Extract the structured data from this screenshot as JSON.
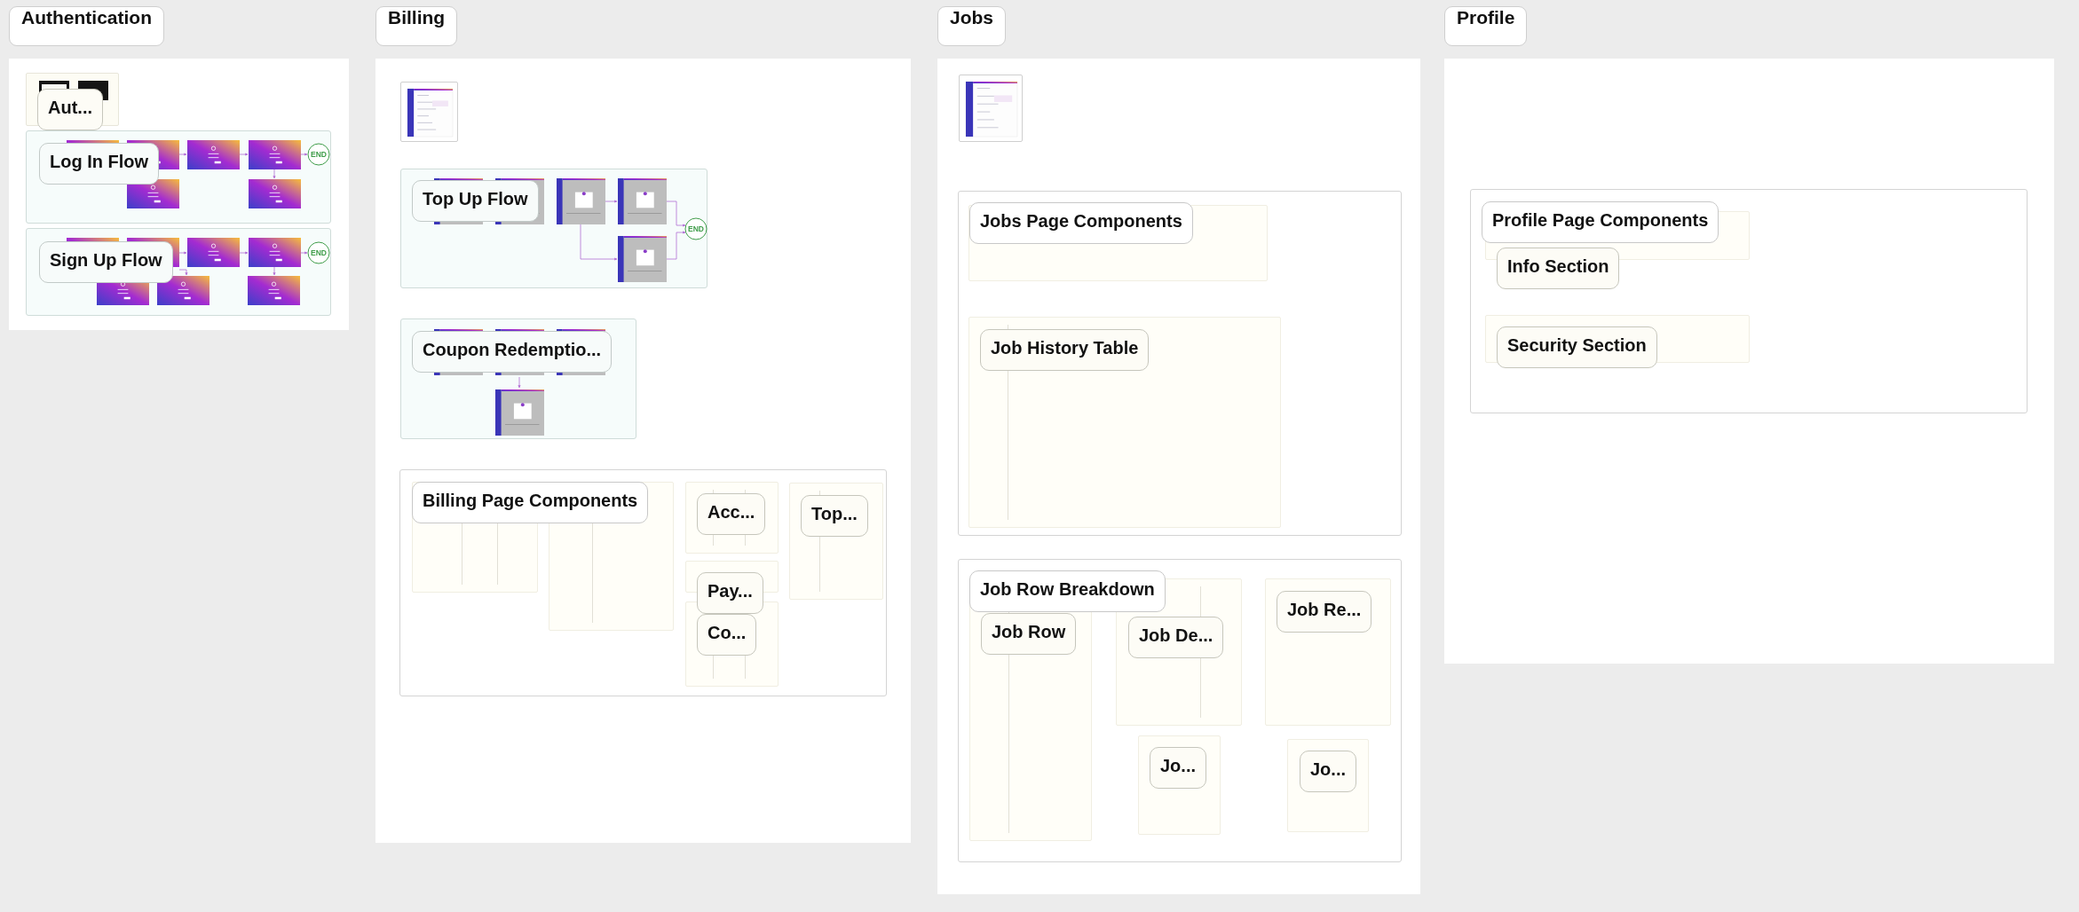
{
  "sections": [
    {
      "title": "Authentication",
      "items": [
        {
          "kind": "thumbnail",
          "label": "Aut..."
        },
        {
          "kind": "flow",
          "label": "Log In Flow",
          "end_label": "END"
        },
        {
          "kind": "flow",
          "label": "Sign Up Flow",
          "end_label": "END"
        }
      ]
    },
    {
      "title": "Billing",
      "items": [
        {
          "kind": "thumbnail"
        },
        {
          "kind": "flow",
          "label": "Top Up Flow",
          "end_label": "END"
        },
        {
          "kind": "flow",
          "label": "Coupon Redemptio..."
        },
        {
          "kind": "group",
          "label": "Billing Page Components",
          "children": [
            {
              "kind": "frame"
            },
            {
              "kind": "frame"
            },
            {
              "kind": "frame",
              "label": "Acc..."
            },
            {
              "kind": "frame",
              "label": "Pay..."
            },
            {
              "kind": "frame",
              "label": "Co..."
            },
            {
              "kind": "frame",
              "label": "Top..."
            }
          ]
        }
      ]
    },
    {
      "title": "Jobs",
      "items": [
        {
          "kind": "thumbnail"
        },
        {
          "kind": "group",
          "label": "Jobs Page Components",
          "children": [
            {
              "kind": "frame"
            },
            {
              "kind": "frame",
              "label": "Job History Table"
            }
          ]
        },
        {
          "kind": "group",
          "label": "Job Row Breakdown",
          "children": [
            {
              "kind": "frame",
              "label": "Job Row"
            },
            {
              "kind": "frame",
              "label": "Job De..."
            },
            {
              "kind": "frame",
              "label": "Job Re..."
            },
            {
              "kind": "frame",
              "label": "Jo..."
            },
            {
              "kind": "frame",
              "label": "Jo..."
            }
          ]
        }
      ]
    },
    {
      "title": "Profile",
      "items": [
        {
          "kind": "group",
          "label": "Profile Page Components",
          "children": [
            {
              "kind": "frame",
              "label": "Info Section"
            },
            {
              "kind": "frame",
              "label": "Security Section"
            }
          ]
        }
      ]
    }
  ]
}
